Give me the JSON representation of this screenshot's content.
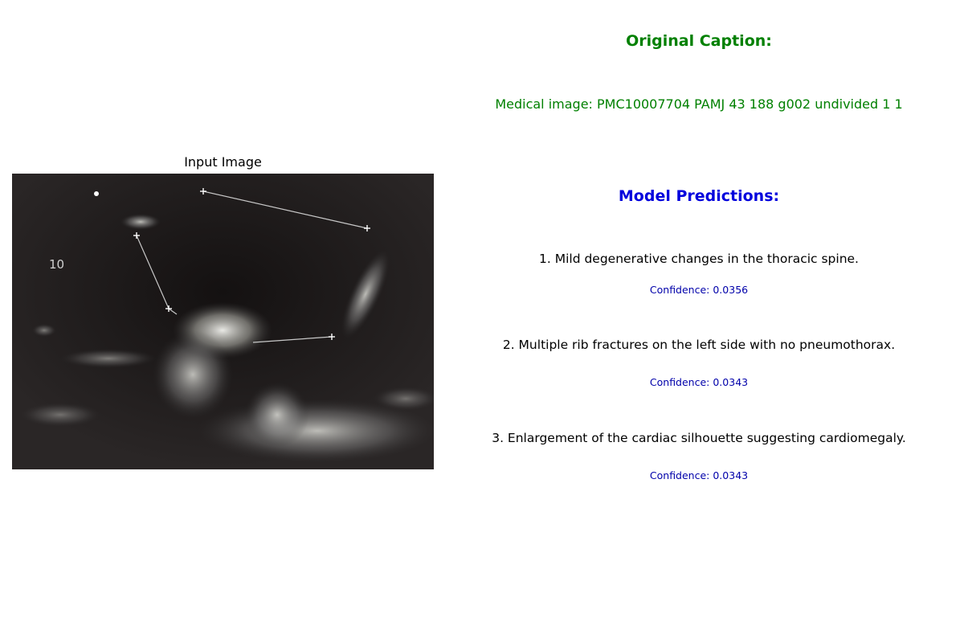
{
  "left_panel": {
    "title": "Input Image",
    "image_overlay_text": "10"
  },
  "right_panel": {
    "caption_heading": "Original Caption:",
    "caption_text": "Medical image: PMC10007704 PAMJ 43 188 g002 undivided 1 1",
    "predictions_heading": "Model Predictions:",
    "predictions": [
      {
        "text": "1. Mild degenerative changes in the thoracic spine.",
        "confidence": "Confidence: 0.0356"
      },
      {
        "text": "2. Multiple rib fractures on the left side with no pneumothorax.",
        "confidence": "Confidence: 0.0343"
      },
      {
        "text": "3. Enlargement of the cardiac silhouette suggesting cardiomegaly.",
        "confidence": "Confidence: 0.0343"
      }
    ]
  },
  "colors": {
    "caption": "#008000",
    "predictions_heading": "#0000dd",
    "confidence": "#0000aa"
  }
}
